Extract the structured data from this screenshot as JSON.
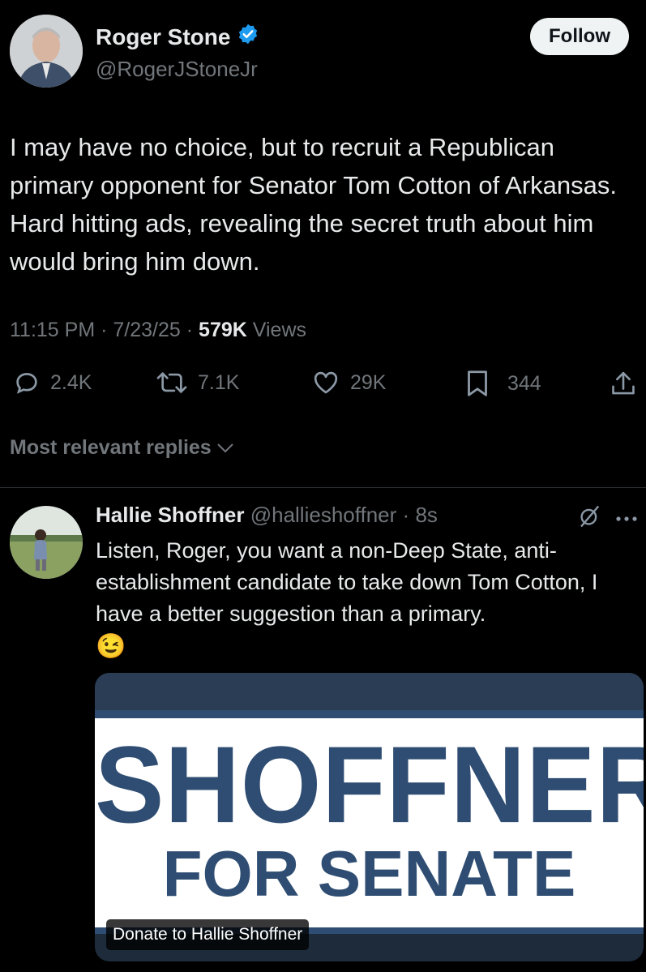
{
  "tweet": {
    "author": {
      "name": "Roger Stone",
      "handle": "@RogerJStoneJr",
      "verified": true
    },
    "follow_label": "Follow",
    "text": "I may have no choice, but to recruit a Republican primary opponent for Senator Tom Cotton of Arkansas. Hard hitting ads, revealing the secret truth about him would bring him down.",
    "time": "11:15 PM",
    "date": "7/23/25",
    "views_count": "579K",
    "views_label": "Views",
    "metrics": {
      "replies": "2.4K",
      "reposts": "7.1K",
      "likes": "29K",
      "bookmarks": "344"
    }
  },
  "replies_sort": {
    "label": "Most relevant replies"
  },
  "reply": {
    "author": {
      "name": "Hallie Shoffner",
      "handle": "@hallieshoffner",
      "time": "8s"
    },
    "text": "Listen, Roger, you want a non-Deep State, anti-establishment candidate to take down Tom Cotton, I have a better suggestion than a primary.",
    "emoji": "😉",
    "card": {
      "headline": "SHOFFNER",
      "subline": "FOR SENATE",
      "caption": "Donate to Hallie Shoffner"
    }
  },
  "colors": {
    "background": "#000000",
    "text": "#e7e9ea",
    "muted": "#71767b",
    "verified": "#1d9bf0",
    "banner_blue": "#2f4d72"
  }
}
